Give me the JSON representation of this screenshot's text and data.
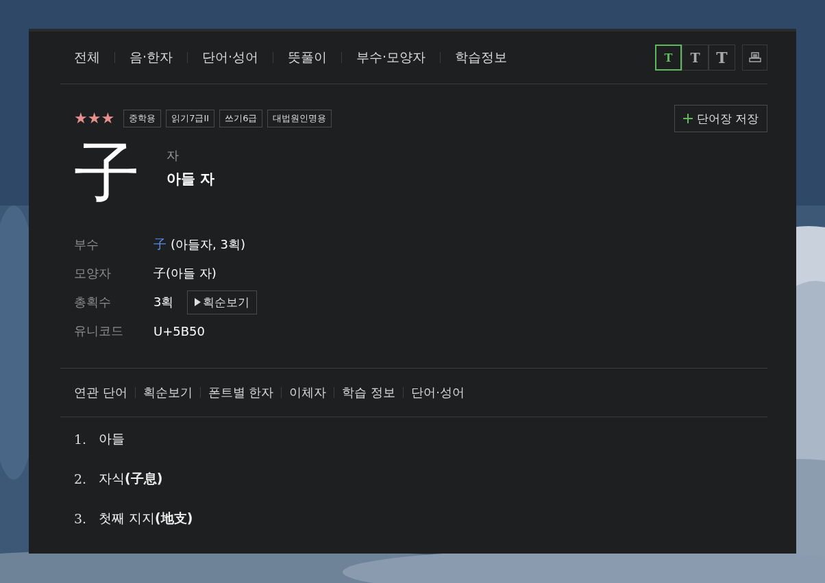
{
  "top_tabs": [
    {
      "label": "전체",
      "selected": false
    },
    {
      "label": "음·한자",
      "selected": false
    },
    {
      "label": "단어·성어",
      "selected": false
    },
    {
      "label": "뜻풀이",
      "selected": false
    },
    {
      "label": "부수·모양자",
      "selected": false
    },
    {
      "label": "학습정보",
      "selected": false
    }
  ],
  "font_sizes": [
    {
      "label": "T",
      "selected": true
    },
    {
      "label": "T",
      "selected": false
    },
    {
      "label": "T",
      "selected": false
    }
  ],
  "header": {
    "stars": 3,
    "tags": [
      "중학용",
      "읽기7급II",
      "쓰기6급",
      "대법원인명용"
    ],
    "save_button": "단어장 저장"
  },
  "hanja": {
    "character": "子",
    "reading": "자",
    "meaning": "아들 자"
  },
  "info": [
    {
      "kind": "radical",
      "label": "부수",
      "link": "子",
      "text": "(아들자, 3획)"
    },
    {
      "kind": "text",
      "label": "모양자",
      "text": "子(아들 자)"
    },
    {
      "kind": "strokes",
      "label": "총획수",
      "text": "3획",
      "button": "획순보기"
    },
    {
      "kind": "text",
      "label": "유니코드",
      "text": "U+5B50"
    }
  ],
  "section_tabs": [
    "연관 단어",
    "획순보기",
    "폰트별 한자",
    "이체자",
    "학습 정보",
    "단어·성어"
  ],
  "meanings": [
    {
      "number": "1.",
      "text": "아들"
    },
    {
      "number": "2.",
      "text": "자식**(子息)**"
    },
    {
      "number": "3.",
      "text": "첫째 지지**(地支)**"
    }
  ]
}
